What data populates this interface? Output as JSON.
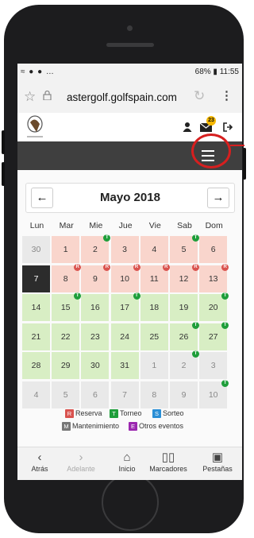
{
  "status_bar": {
    "left": "≈ ● ● …",
    "right": "68% ▮ 11:55"
  },
  "browser": {
    "url": "astergolf.golfspain.com"
  },
  "site": {
    "notification_count": "23"
  },
  "calendar": {
    "month_label": "Mayo 2018",
    "weekdays": [
      "Lun",
      "Mar",
      "Mie",
      "Jue",
      "Vie",
      "Sab",
      "Dom"
    ],
    "weeks": [
      [
        {
          "d": "30",
          "s": "gray"
        },
        {
          "d": "1",
          "s": "red"
        },
        {
          "d": "2",
          "s": "red",
          "m": "T"
        },
        {
          "d": "3",
          "s": "red"
        },
        {
          "d": "4",
          "s": "red"
        },
        {
          "d": "5",
          "s": "red",
          "m": "T"
        },
        {
          "d": "6",
          "s": "red"
        }
      ],
      [
        {
          "d": "7",
          "s": "dark"
        },
        {
          "d": "8",
          "s": "red",
          "m": "R"
        },
        {
          "d": "9",
          "s": "red",
          "m": "R"
        },
        {
          "d": "10",
          "s": "red",
          "m": "R"
        },
        {
          "d": "11",
          "s": "red",
          "m": "R"
        },
        {
          "d": "12",
          "s": "red",
          "m": "R"
        },
        {
          "d": "13",
          "s": "red",
          "m": "R"
        }
      ],
      [
        {
          "d": "14",
          "s": "green"
        },
        {
          "d": "15",
          "s": "green",
          "m": "T"
        },
        {
          "d": "16",
          "s": "green"
        },
        {
          "d": "17",
          "s": "green",
          "m": "T"
        },
        {
          "d": "18",
          "s": "green"
        },
        {
          "d": "19",
          "s": "green"
        },
        {
          "d": "20",
          "s": "green",
          "m": "T"
        }
      ],
      [
        {
          "d": "21",
          "s": "green"
        },
        {
          "d": "22",
          "s": "green"
        },
        {
          "d": "23",
          "s": "green"
        },
        {
          "d": "24",
          "s": "green"
        },
        {
          "d": "25",
          "s": "green"
        },
        {
          "d": "26",
          "s": "green",
          "m": "T"
        },
        {
          "d": "27",
          "s": "green",
          "m": "T"
        }
      ],
      [
        {
          "d": "28",
          "s": "green"
        },
        {
          "d": "29",
          "s": "green"
        },
        {
          "d": "30",
          "s": "green"
        },
        {
          "d": "31",
          "s": "green"
        },
        {
          "d": "1",
          "s": "gray"
        },
        {
          "d": "2",
          "s": "gray",
          "m": "T"
        },
        {
          "d": "3",
          "s": "gray"
        }
      ],
      [
        {
          "d": "4",
          "s": "gray"
        },
        {
          "d": "5",
          "s": "gray"
        },
        {
          "d": "6",
          "s": "gray"
        },
        {
          "d": "7",
          "s": "gray"
        },
        {
          "d": "8",
          "s": "gray"
        },
        {
          "d": "9",
          "s": "gray"
        },
        {
          "d": "10",
          "s": "gray",
          "m": "T"
        }
      ]
    ]
  },
  "legend": {
    "row1": [
      {
        "code": "R",
        "label": "Reserva",
        "color": "#d9534f"
      },
      {
        "code": "T",
        "label": "Torneo",
        "color": "#1e9e3a"
      },
      {
        "code": "S",
        "label": "Sorteo",
        "color": "#2a8fd6"
      }
    ],
    "row2": [
      {
        "code": "M",
        "label": "Mantenimiento",
        "color": "#777777"
      },
      {
        "code": "E",
        "label": "Otros eventos",
        "color": "#9b27af"
      }
    ]
  },
  "bottom_nav": [
    {
      "icon": "back-icon",
      "label": "Atrás",
      "enabled": true
    },
    {
      "icon": "forward-icon",
      "label": "Adelante",
      "enabled": false
    },
    {
      "icon": "home-icon",
      "label": "Inicio",
      "enabled": true
    },
    {
      "icon": "bookmarks-icon",
      "label": "Marcadores",
      "enabled": true
    },
    {
      "icon": "tabs-icon",
      "label": "Pestañas",
      "enabled": true
    }
  ],
  "colors": {
    "navbar": "#3f3f3f",
    "highlight": "#d61f1f",
    "reserva": "#f9d5cc",
    "torneo_day": "#d8eec4"
  }
}
